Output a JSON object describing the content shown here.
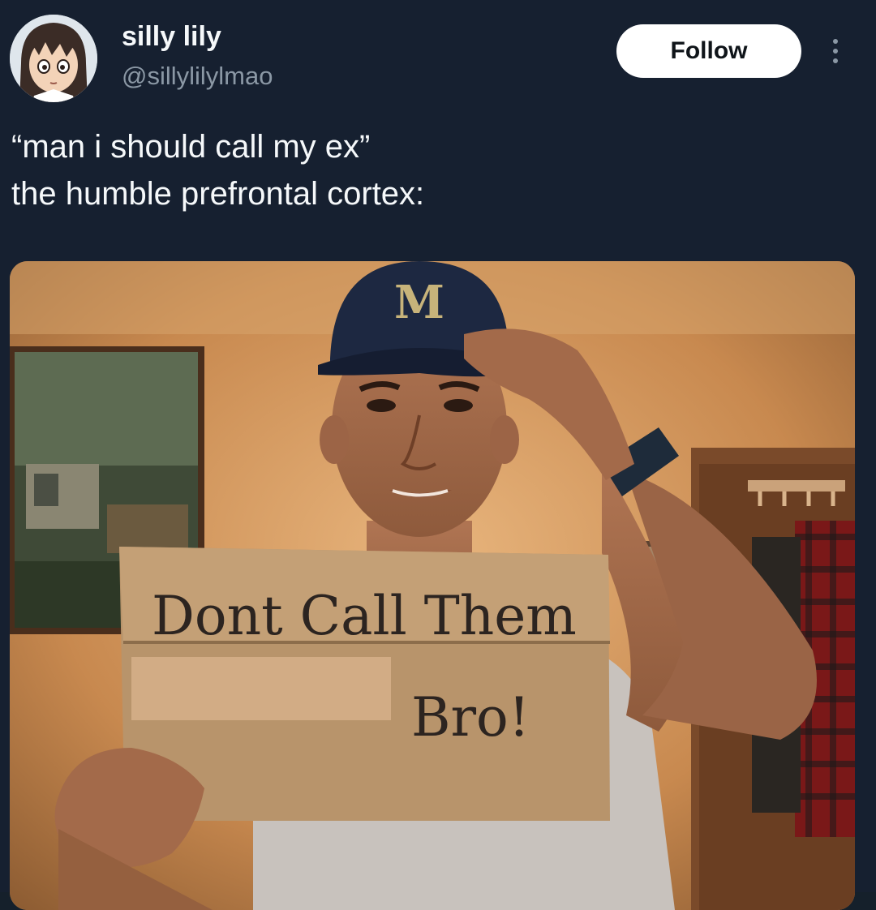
{
  "post": {
    "author": {
      "display_name": "silly lily",
      "handle": "@sillylilylmao"
    },
    "follow_label": "Follow",
    "text_lines": [
      "“man i should call my ex”",
      "the humble prefrontal cortex:"
    ],
    "media": {
      "cap_letter": "M",
      "sign_line_1": "Dont Call Them",
      "sign_line_2": "Bro!"
    }
  },
  "icons": {
    "more": "more-vertical-icon"
  },
  "colors": {
    "background": "#162030",
    "follow_button_bg": "#ffffff",
    "secondary_text": "#8b98a5"
  }
}
